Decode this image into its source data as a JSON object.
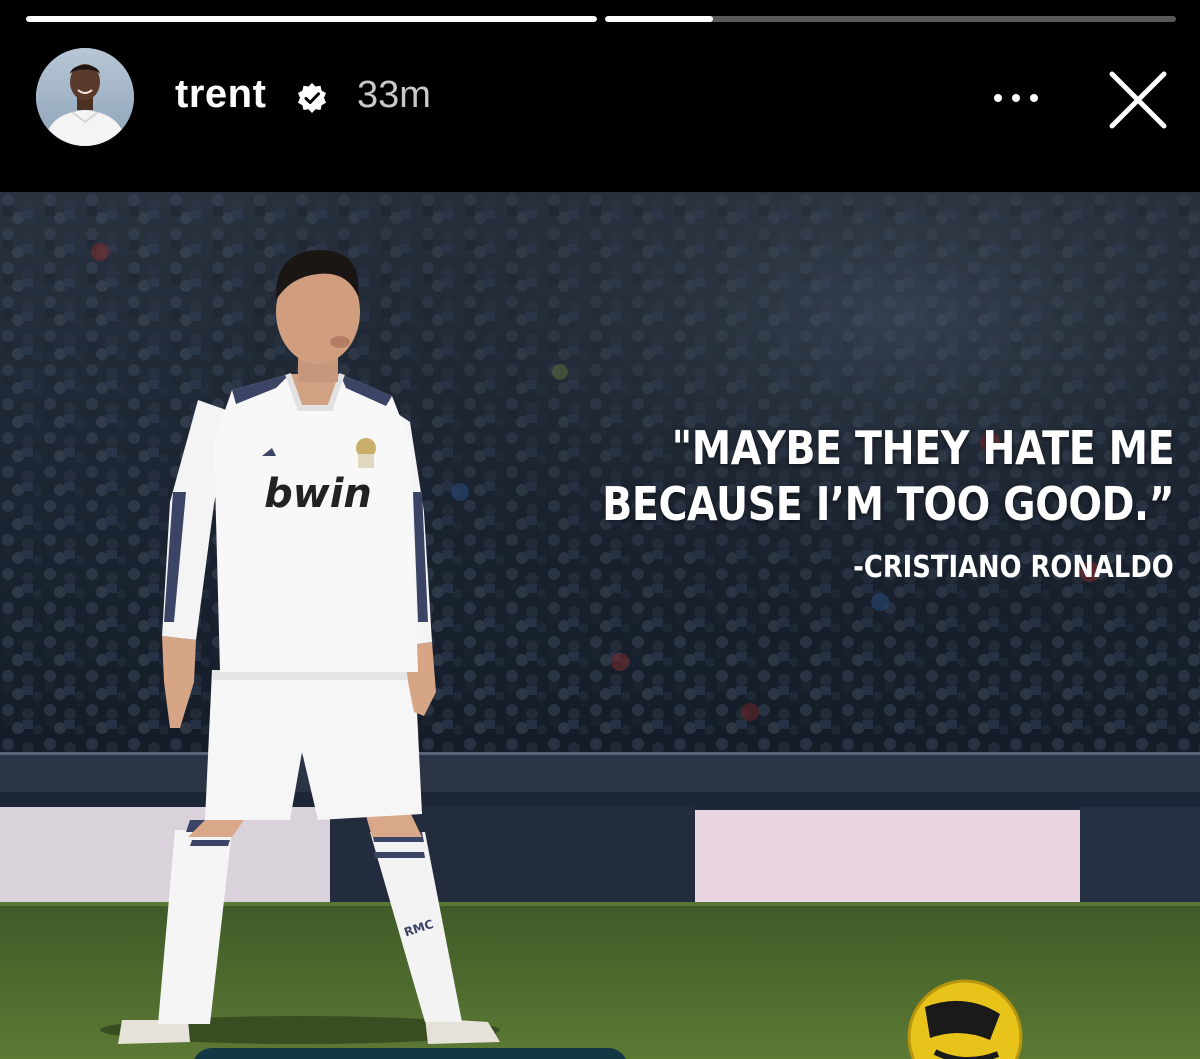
{
  "story": {
    "progress": [
      {
        "fill": 1.0
      },
      {
        "fill": 0.19
      }
    ],
    "header": {
      "username": "trent",
      "time_ago": "33m",
      "verified_icon": "verified-badge-icon",
      "more_icon": "more-dots-icon",
      "close_icon": "close-icon"
    },
    "image": {
      "quote_line1": "\"MAYBE THEY HATE ME",
      "quote_line2": "BECAUSE I’M TOO GOOD.”",
      "attribution": "-CRISTIANO RONALDO",
      "jersey_sponsor": "bwin",
      "sock_text": "RMC"
    }
  },
  "colors": {
    "background": "#000000",
    "text": "#ffffff",
    "muted_text": "#c9c9c9",
    "pitch": "#4d6a2c",
    "crowd": "#1a2233",
    "reply_bar": "#143745"
  }
}
